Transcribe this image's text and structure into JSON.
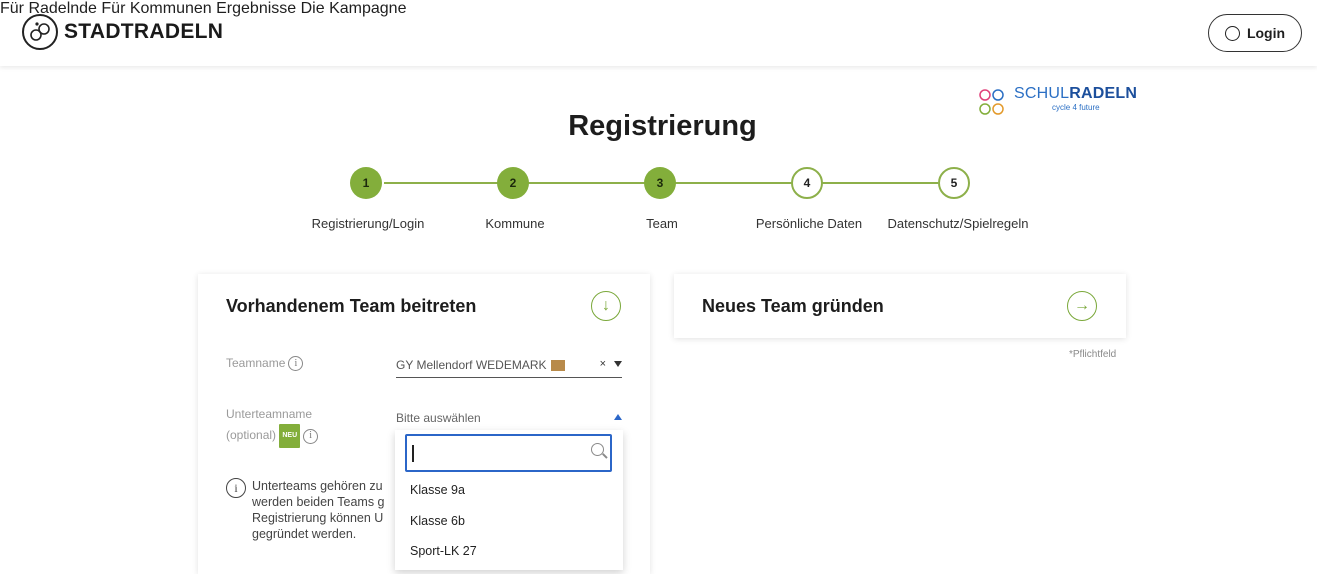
{
  "header": {
    "logo_text": "STADTRADELN",
    "nav": [
      "Für Radelnde",
      "Für Kommunen",
      "Ergebnisse",
      "Die Kampagne"
    ],
    "login_label": "Login"
  },
  "brand": {
    "schul_prefix": "SCHUL",
    "schul_bold": "RADELN",
    "schul_sub": "cycle 4 future",
    "accent": "#83ae3b",
    "focus": "#2b66c8"
  },
  "page_title": "Registrierung",
  "steps": [
    {
      "num": "1",
      "label": "Registrierung/Login",
      "state": "done"
    },
    {
      "num": "2",
      "label": "Kommune",
      "state": "done"
    },
    {
      "num": "3",
      "label": "Team",
      "state": "done"
    },
    {
      "num": "4",
      "label": "Persönliche Daten",
      "state": "todo"
    },
    {
      "num": "5",
      "label": "Datenschutz/Spielregeln",
      "state": "todo"
    }
  ],
  "join_card": {
    "title": "Vorhandenem Team beitreten",
    "teamname_label": "Teamname",
    "teamname_value": "GY Mellendorf WEDEMARK",
    "clear": "×",
    "subteam_label_1": "Unterteamname",
    "subteam_label_2": "(optional)",
    "neu_badge": "NEU",
    "subteam_placeholder": "Bitte auswählen",
    "info_text": "Unterteams gehören zu werden beiden Teams g Registrierung können U gegründet werden."
  },
  "new_card": {
    "title": "Neues Team gründen",
    "required_note": "*Pflichtfeld"
  },
  "dropdown": {
    "search_value": "",
    "options": [
      "Klasse 9a",
      "Klasse 6b",
      "Sport-LK 27"
    ]
  }
}
